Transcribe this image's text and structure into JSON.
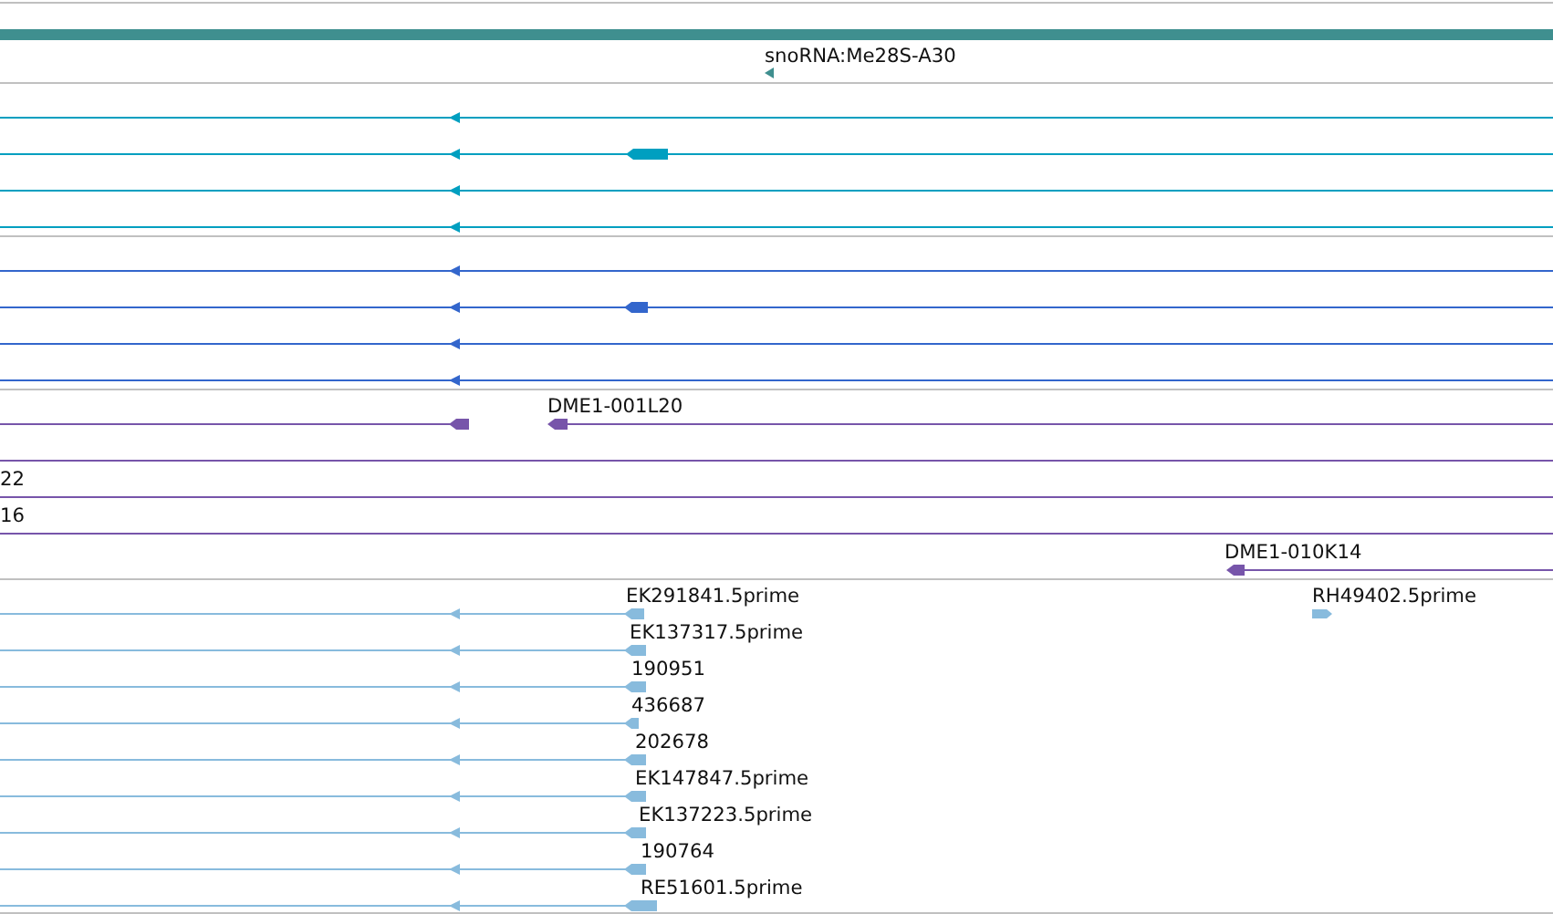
{
  "tracks": [
    {
      "color": "#3f8f8f",
      "features": [
        {
          "kind": "band"
        },
        {
          "kind": "mark",
          "label": "snoRNA:Me28S-A30"
        }
      ]
    },
    {
      "color": "#009fc0",
      "features": [
        {
          "kind": "transcript"
        },
        {
          "kind": "transcript_block"
        },
        {
          "kind": "transcript"
        },
        {
          "kind": "transcript"
        }
      ]
    },
    {
      "color": "#3366cc",
      "features": [
        {
          "kind": "transcript"
        },
        {
          "kind": "transcript_block"
        },
        {
          "kind": "transcript"
        },
        {
          "kind": "transcript"
        }
      ]
    },
    {
      "color": "#7755aa",
      "features": [
        {
          "kind": "split",
          "label": "DME1-001L20"
        },
        {
          "kind": "line"
        },
        {
          "kind": "line",
          "label": "22"
        },
        {
          "kind": "line",
          "label": "16"
        },
        {
          "kind": "partial",
          "label": "DME1-010K14"
        }
      ]
    },
    {
      "color": "#88bbdd",
      "features": [
        {
          "kind": "est",
          "label": "EK291841.5prime"
        },
        {
          "kind": "forward",
          "label": "RH49402.5prime"
        },
        {
          "kind": "est",
          "label": "EK137317.5prime"
        },
        {
          "kind": "est",
          "label": "190951"
        },
        {
          "kind": "est",
          "label": "436687"
        },
        {
          "kind": "est",
          "label": "202678"
        },
        {
          "kind": "est",
          "label": "EK147847.5prime"
        },
        {
          "kind": "est",
          "label": "EK137223.5prime"
        },
        {
          "kind": "est",
          "label": "190764"
        },
        {
          "kind": "est",
          "label": "RE51601.5prime"
        }
      ]
    }
  ]
}
